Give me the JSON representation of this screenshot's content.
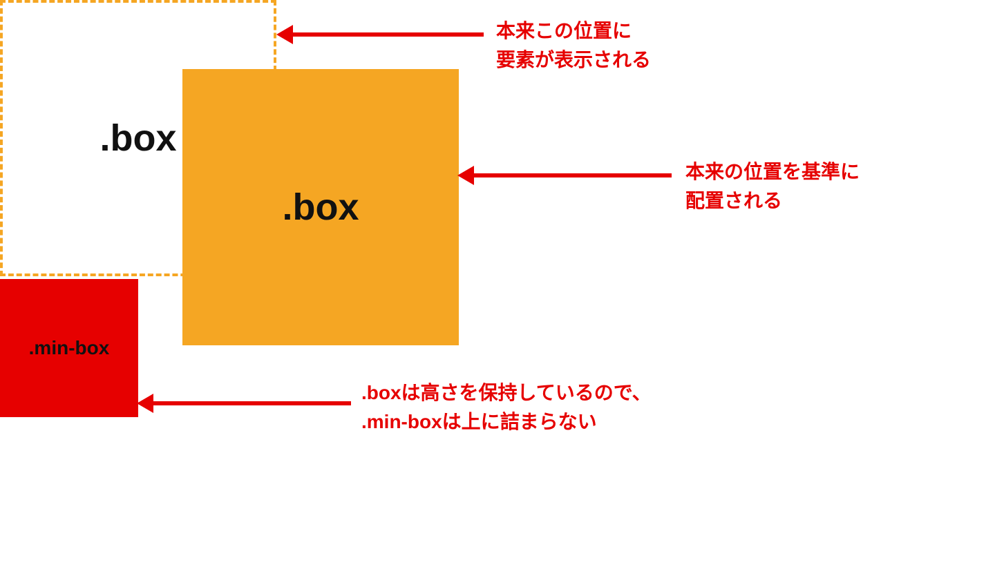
{
  "boxes": {
    "dashed": {
      "label": ".box"
    },
    "solid": {
      "label": ".box"
    },
    "min": {
      "label": ".min-box"
    }
  },
  "annotations": {
    "a1": {
      "line1": "本来この位置に",
      "line2": "要素が表示される"
    },
    "a2": {
      "line1": "本来の位置を基準に",
      "line2": "配置される"
    },
    "a3": {
      "line1": ".boxは高さを保持しているので、",
      "line2": ".min-boxは上に詰まらない"
    }
  },
  "colors": {
    "accent_orange": "#f5a623",
    "accent_red": "#e60000"
  }
}
